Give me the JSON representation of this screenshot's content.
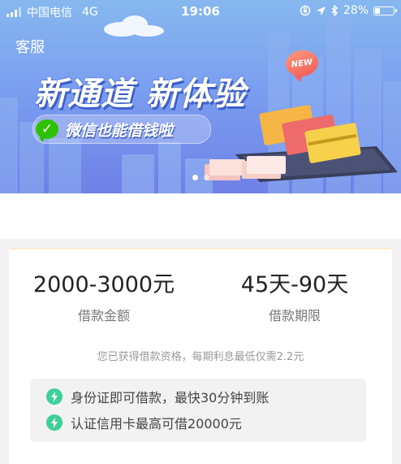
{
  "status_bar": {
    "carrier": "中国电信",
    "network": "4G",
    "time": "19:06",
    "battery_percent": "28%",
    "battery_level": 0.28
  },
  "header": {
    "service_label": "客服"
  },
  "banner": {
    "headline": "新通道 新体验",
    "badge": "NEW",
    "subtitle": "微信也能借钱啦",
    "carousel_dots": 2,
    "active_dot": 0
  },
  "loan": {
    "amount_value": "2000-3000元",
    "amount_label": "借款金额",
    "term_value": "45天-90天",
    "term_label": "借款期限",
    "note": "您已获得借款资格，每期利息最低仅需2.2元"
  },
  "features": [
    {
      "icon": "lightning-icon",
      "text": "身份证即可借款，最快30分钟到账"
    },
    {
      "icon": "lightning-icon",
      "text": "认证信用卡最高可借20000元"
    }
  ],
  "colors": {
    "banner_top": "#86b8ef",
    "banner_bottom": "#6f80e6",
    "feature_icon": "#3fcf9a",
    "wechat_green": "#2dc100",
    "new_badge": "#f05a5a"
  }
}
